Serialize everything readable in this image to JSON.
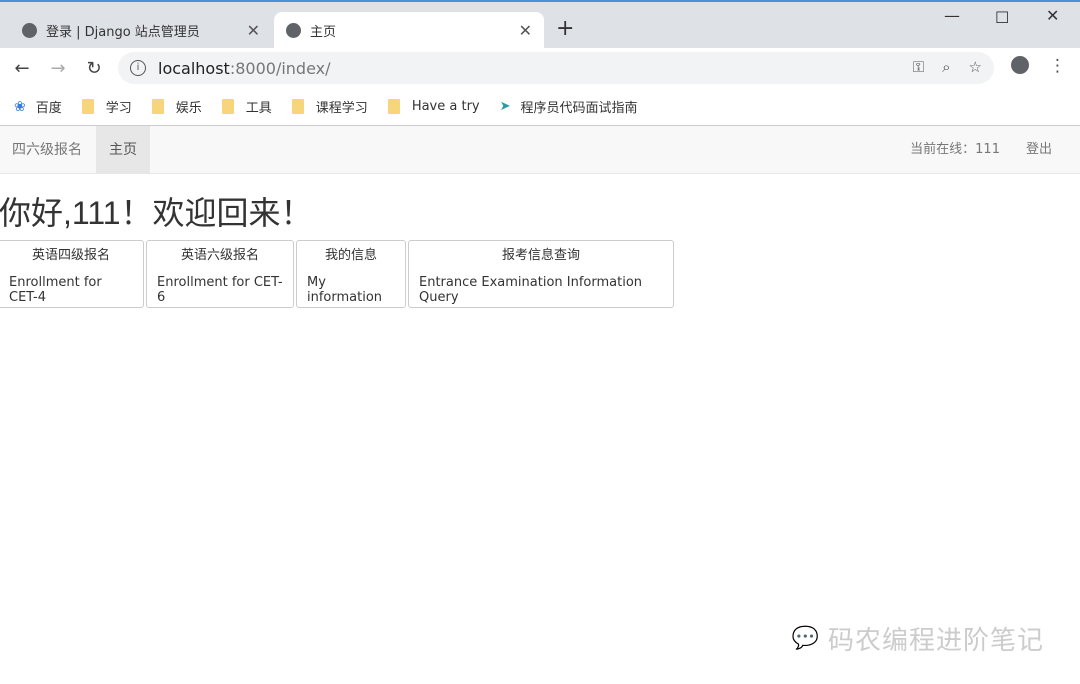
{
  "browser": {
    "tabs": [
      {
        "title": "登录 | Django 站点管理员",
        "active": false
      },
      {
        "title": "主页",
        "active": true
      }
    ],
    "url_host": "localhost",
    "url_rest": ":8000/index/",
    "bookmarks": [
      "百度",
      "学习",
      "娱乐",
      "工具",
      "课程学习",
      "Have a try",
      "程序员代码面试指南"
    ]
  },
  "navbar": {
    "brand": "四六级报名",
    "home": "主页",
    "online": "当前在线：111",
    "logout": "登出"
  },
  "main": {
    "greeting": "你好,111！欢迎回来！",
    "cards": [
      {
        "cn": "英语四级报名",
        "en": "Enrollment for CET-4"
      },
      {
        "cn": "英语六级报名",
        "en": "Enrollment for CET-6"
      },
      {
        "cn": "我的信息",
        "en": "My information"
      },
      {
        "cn": "报考信息查询",
        "en": "Entrance Examination Information Query"
      }
    ]
  },
  "watermark": "码农编程进阶笔记"
}
